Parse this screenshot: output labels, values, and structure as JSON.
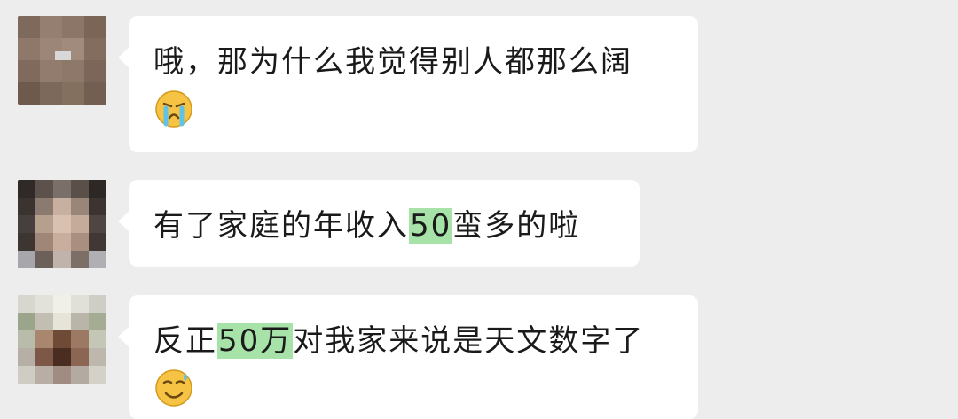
{
  "messages": [
    {
      "id": "m1",
      "text": "哦，那为什么我觉得别人都那么阔",
      "emoji": "crying-face-icon"
    },
    {
      "id": "m2",
      "parts": [
        "有了家庭的年收入",
        "50",
        "蛮多的啦"
      ]
    },
    {
      "id": "m3",
      "parts": [
        "反正",
        "50万",
        "对我家来说是天文数字了"
      ],
      "emoji": "sweat-smile-face-icon"
    }
  ],
  "colors": {
    "background": "#ededed",
    "bubble": "#ffffff",
    "highlight": "#a7e3a9",
    "text": "#1a1a1a"
  }
}
